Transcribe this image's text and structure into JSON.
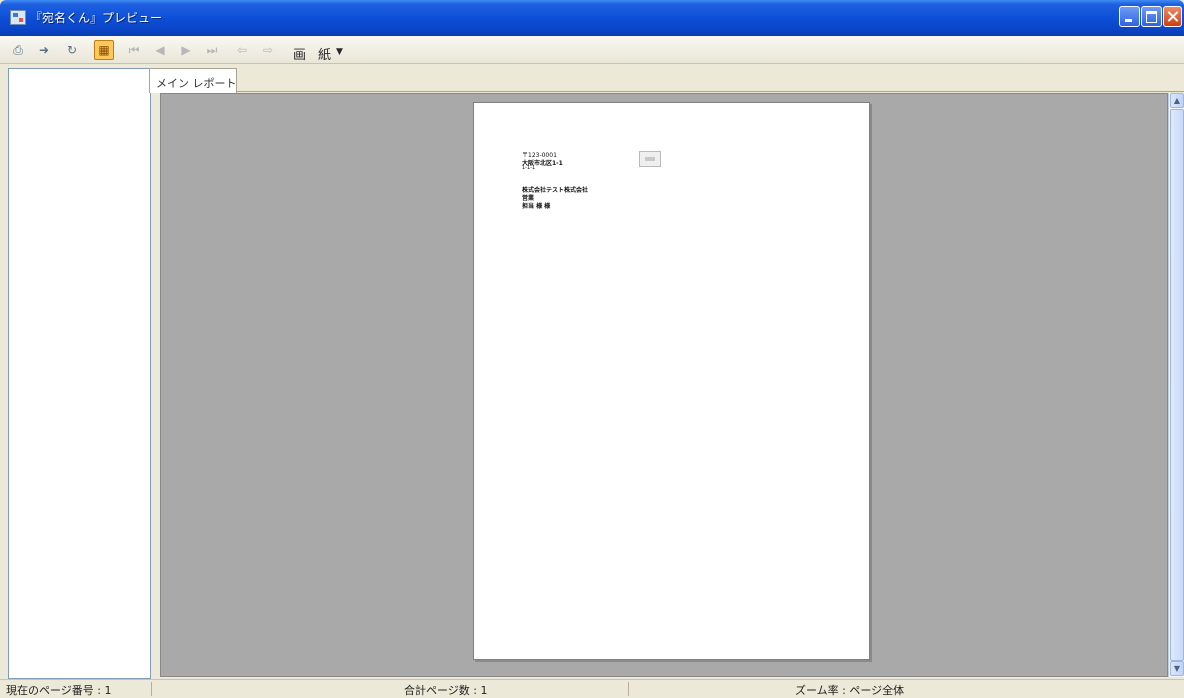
{
  "window": {
    "title": "『宛名くん』プレビュー"
  },
  "toolbar": {
    "buttons": [
      {
        "name": "print-button",
        "icon": "printer-icon"
      },
      {
        "name": "export-button",
        "icon": "export-icon"
      },
      {
        "name": "refresh-button",
        "icon": "refresh-icon"
      },
      {
        "name": "thumbnails-toggle-button",
        "icon": "thumbnails-icon",
        "active": true
      },
      {
        "name": "first-page-button",
        "icon": "first-page-icon",
        "disabled": true
      },
      {
        "name": "previous-page-button",
        "icon": "previous-page-icon",
        "disabled": true
      },
      {
        "name": "next-page-button",
        "icon": "next-page-icon",
        "disabled": true
      },
      {
        "name": "last-page-button",
        "icon": "last-page-icon",
        "disabled": true
      },
      {
        "name": "back-button",
        "icon": "back-icon",
        "disabled": true
      },
      {
        "name": "forward-button",
        "icon": "forward-icon",
        "disabled": true
      }
    ],
    "print_label": "画",
    "zoom_label": "紙"
  },
  "tabs": [
    {
      "label": "メイン レポート"
    }
  ],
  "preview": {
    "postal": "〒123-0001",
    "address_line1": "大阪市北区1-1",
    "address_line2": "1-1-1",
    "company": "株式会社テスト株式会社",
    "dept": "営業",
    "person": "担当 様 様"
  },
  "status": {
    "current_page": "現在のページ番号 : 1",
    "total_pages": "合計ページ数 : 1",
    "zoom": "ズーム率 : ページ全体"
  },
  "colors": {
    "titlebar": "#0d4fd8",
    "workspace": "#a9a9a9",
    "chrome": "#ece9d8",
    "active_button": "#ffc95a"
  }
}
